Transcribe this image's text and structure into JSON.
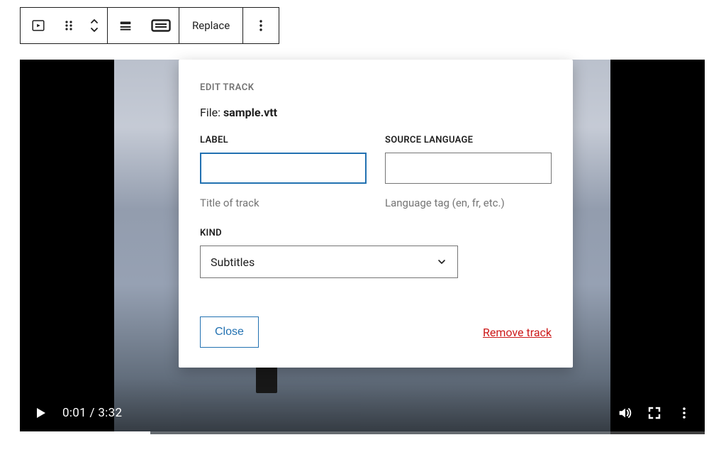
{
  "toolbar": {
    "replace_label": "Replace"
  },
  "player": {
    "time_display": "0:01 / 3:32"
  },
  "popover": {
    "eyebrow": "EDIT TRACK",
    "file_prefix": "File: ",
    "file_name": "sample.vtt",
    "label_heading": "LABEL",
    "label_value": "",
    "label_help": "Title of track",
    "lang_heading": "SOURCE LANGUAGE",
    "lang_value": "",
    "lang_help": "Language tag (en, fr, etc.)",
    "kind_heading": "KIND",
    "kind_value": "Subtitles",
    "close_label": "Close",
    "remove_label": "Remove track"
  }
}
